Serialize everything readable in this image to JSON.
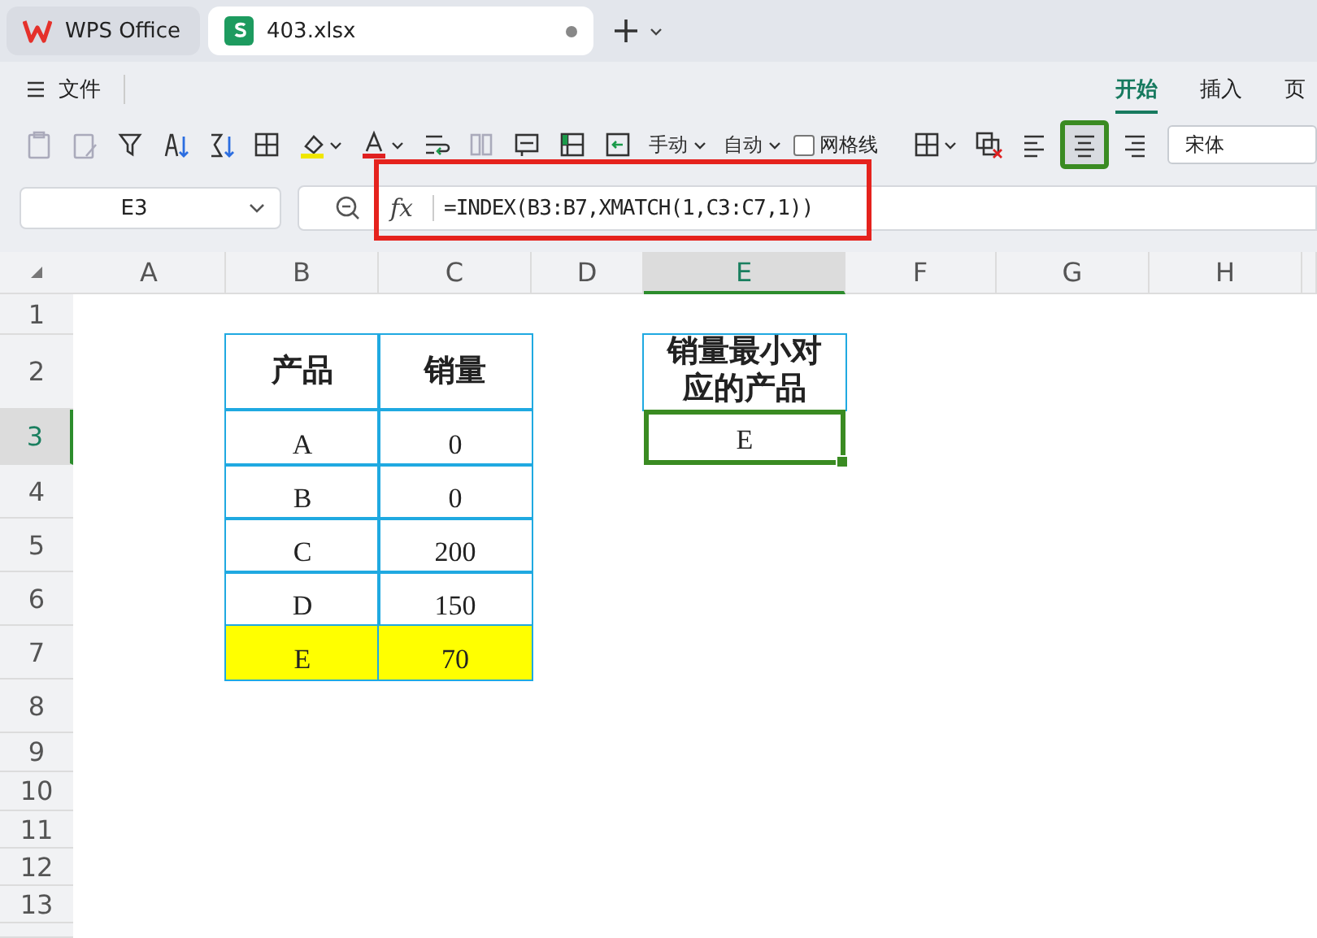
{
  "tabs": [
    {
      "kind": "home",
      "label": "WPS Office",
      "selected": false
    },
    {
      "kind": "sheet",
      "label": "403.xlsx",
      "selected": true
    }
  ],
  "menu": {
    "file": "文件",
    "ribbon_tabs": [
      {
        "label": "开始",
        "selected": true
      },
      {
        "label": "插入",
        "selected": false
      },
      {
        "label": "页",
        "selected": false
      }
    ]
  },
  "toolbar": [
    {
      "kind": "icon",
      "disabled": true
    },
    {
      "kind": "icon",
      "disabled": true
    },
    {
      "kind": "icon",
      "disabled": false
    },
    {
      "kind": "icon",
      "disabled": false
    },
    {
      "kind": "icon",
      "disabled": false
    },
    {
      "kind": "icon",
      "disabled": false
    },
    {
      "kind": "icon",
      "disabled": false
    },
    {
      "kind": "icon",
      "disabled": false
    },
    {
      "kind": "icon",
      "disabled": false
    },
    {
      "kind": "icon",
      "disabled": true
    },
    {
      "kind": "icon",
      "disabled": false
    },
    {
      "kind": "icon",
      "disabled": false
    },
    {
      "kind": "icon",
      "disabled": false
    },
    {
      "kind": "dropdown",
      "label": "手动"
    },
    {
      "kind": "dropdown",
      "label": "自动"
    },
    {
      "kind": "checkbox",
      "label": "网格线",
      "checked": false
    },
    {
      "kind": "icon",
      "disabled": false
    },
    {
      "kind": "icon",
      "disabled": false
    },
    {
      "kind": "icon",
      "disabled": false,
      "selected": false
    },
    {
      "kind": "icon",
      "disabled": false,
      "selected": true
    },
    {
      "kind": "icon",
      "disabled": false,
      "selected": false
    },
    {
      "kind": "font",
      "value": "宋体"
    }
  ],
  "name_box": {
    "value": "E3"
  },
  "formula_bar": {
    "function_label": "fx",
    "formula": "=INDEX(B3:B7,XMATCH(1,C3:C7,1))"
  },
  "annotations": [
    {
      "kind": "highlight-box"
    }
  ],
  "sheet": {
    "columns": [
      {
        "label": "A",
        "selected": false
      },
      {
        "label": "B",
        "selected": false
      },
      {
        "label": "C",
        "selected": false
      },
      {
        "label": "D",
        "selected": false
      },
      {
        "label": "E",
        "selected": true
      },
      {
        "label": "F",
        "selected": false
      },
      {
        "label": "G",
        "selected": false
      },
      {
        "label": "H",
        "selected": false
      }
    ],
    "rows": [
      {
        "number": "1",
        "selected": false
      },
      {
        "number": "2",
        "selected": false
      },
      {
        "number": "3",
        "selected": true
      },
      {
        "number": "4",
        "selected": false
      },
      {
        "number": "5",
        "selected": false
      },
      {
        "number": "6",
        "selected": false
      },
      {
        "number": "7",
        "selected": false
      },
      {
        "number": "8",
        "selected": false
      },
      {
        "number": "9",
        "selected": false
      },
      {
        "number": "10",
        "selected": false
      },
      {
        "number": "11",
        "selected": false
      },
      {
        "number": "12",
        "selected": false
      },
      {
        "number": "13",
        "selected": false
      }
    ]
  },
  "product_table": {
    "headers": [
      "产品",
      "销量"
    ],
    "rows": [
      {
        "product": "A",
        "sales": "0",
        "highlighted": false
      },
      {
        "product": "B",
        "sales": "0",
        "highlighted": false
      },
      {
        "product": "C",
        "sales": "200",
        "highlighted": false
      },
      {
        "product": "D",
        "sales": "150",
        "highlighted": false
      },
      {
        "product": "E",
        "sales": "70",
        "highlighted": true
      }
    ]
  },
  "result": {
    "header": "销量最小对应的产品",
    "value": "E",
    "selected": true
  }
}
